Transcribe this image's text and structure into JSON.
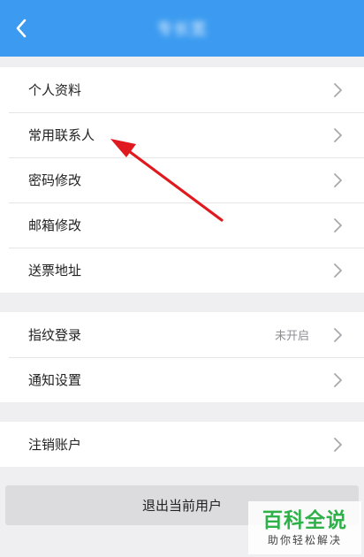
{
  "header": {
    "title": "专长宽"
  },
  "group_account": {
    "items": [
      {
        "label": "个人资料"
      },
      {
        "label": "常用联系人"
      },
      {
        "label": "密码修改"
      },
      {
        "label": "邮箱修改"
      },
      {
        "label": "送票地址"
      }
    ]
  },
  "group_security": {
    "items": [
      {
        "label": "指纹登录",
        "value": "未开启"
      },
      {
        "label": "通知设置"
      }
    ]
  },
  "group_cancel": {
    "items": [
      {
        "label": "注销账户"
      }
    ]
  },
  "logout_label": "退出当前用户",
  "watermark": {
    "brand": "百科全说",
    "slogan": "助你轻松解决"
  },
  "colors": {
    "header": "#3c9bf0",
    "background": "#efeff1",
    "annotation_arrow": "#e0191e",
    "watermark_green": "#2fb14a"
  }
}
